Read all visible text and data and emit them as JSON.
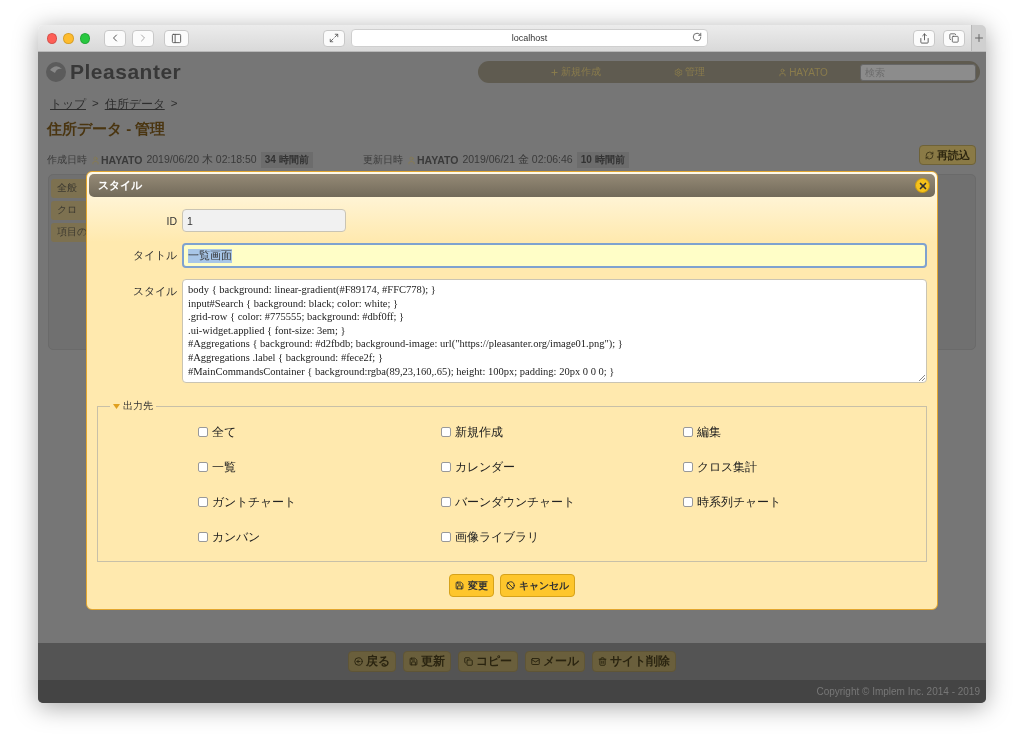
{
  "browser": {
    "url": "localhost"
  },
  "header": {
    "logo": "Pleasanter",
    "nav": [
      {
        "label": "新規作成",
        "kind": "plus"
      },
      {
        "label": "管理",
        "kind": "gear"
      },
      {
        "label": "HAYATO",
        "kind": "user"
      }
    ],
    "search": {
      "placeholder": "検索"
    }
  },
  "breadcrumbs": {
    "items": [
      "トップ",
      "住所データ"
    ],
    "separator": ">"
  },
  "title": "住所データ - 管理",
  "info": [
    {
      "label": "作成日時",
      "user": "HAYATO",
      "datetime": "2019/06/20 木 02:18:50",
      "ago": "34 時間前"
    },
    {
      "label": "更新日時",
      "user": "HAYATO",
      "datetime": "2019/06/21 金 02:06:46",
      "ago": "10 時間前"
    }
  ],
  "reload_button": "再読込",
  "tabs": [
    "全般",
    "クロ",
    "項目の"
  ],
  "dialog": {
    "title": "スタイル",
    "fields": [
      {
        "kind": "input",
        "label": "ID",
        "value": "1",
        "focused": false
      },
      {
        "kind": "input",
        "label": "タイトル",
        "value": "一覧画面",
        "focused": true
      },
      {
        "kind": "textarea",
        "label": "スタイル",
        "lines": [
          "body { background: linear-gradient(#F89174, #FFC778); }",
          "input#Search { background: black; color: white; }",
          ".grid-row { color: #775555; background: #dbf0ff; }",
          ".ui-widget.applied { font-size: 3em; }",
          "#Aggregations { background: #d2fbdb; background-image: url(\"https://pleasanter.org/image01.png\"); }",
          "#Aggregations .label { background: #fece2f; }",
          "#MainCommandsContainer { background:rgba(89,23,160,.65); height: 100px; padding: 20px 0 0 0; }"
        ]
      }
    ],
    "output_targets": {
      "legend": "出力先",
      "expanded": true,
      "options": [
        {
          "label": "全て",
          "checked": false
        },
        {
          "label": "新規作成",
          "checked": false
        },
        {
          "label": "編集",
          "checked": false
        },
        {
          "label": "一覧",
          "checked": false
        },
        {
          "label": "カレンダー",
          "checked": false
        },
        {
          "label": "クロス集計",
          "checked": false
        },
        {
          "label": "ガントチャート",
          "checked": false
        },
        {
          "label": "バーンダウンチャート",
          "checked": false
        },
        {
          "label": "時系列チャート",
          "checked": false
        },
        {
          "label": "カンバン",
          "checked": false
        },
        {
          "label": "画像ライブラリ",
          "checked": false
        }
      ]
    },
    "buttons": [
      {
        "label": "変更",
        "kind": "save"
      },
      {
        "label": "キャンセル",
        "kind": "cancel"
      }
    ]
  },
  "footer_buttons": [
    {
      "label": "戻る",
      "kind": "back"
    },
    {
      "label": "更新",
      "kind": "save"
    },
    {
      "label": "コピー",
      "kind": "copy"
    },
    {
      "label": "メール",
      "kind": "mail"
    },
    {
      "label": "サイト削除",
      "kind": "trash"
    }
  ],
  "copyright": "Copyright © Implem Inc. 2014 - 2019"
}
